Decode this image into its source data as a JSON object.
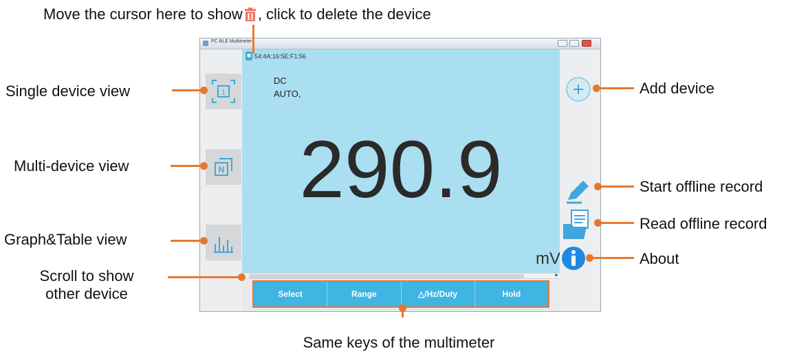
{
  "annotations": {
    "delete_prefix": "Move the cursor here to show",
    "delete_suffix": ", click to delete the device",
    "single_view": "Single device view",
    "multi_view": "Multi-device view",
    "graph_view": "Graph&Table view",
    "scroll_line1": "Scroll to show",
    "scroll_line2": "other device",
    "same_keys": "Same keys of the multimeter",
    "add_device": "Add device",
    "start_record": "Start offline record",
    "read_record": "Read offline record",
    "about": "About"
  },
  "window": {
    "title": "PC BLE Multimeter"
  },
  "device": {
    "address": "54:4A:16:5E:F1:56",
    "mode_line1": "DC",
    "mode_line2": "AUTO,",
    "reading": "290.9",
    "unit": "mV"
  },
  "left_panel": {
    "single_label": "1",
    "multi_label": "N"
  },
  "keys": [
    "Select",
    "Range",
    "△/Hz/Duty",
    "Hold"
  ],
  "colors": {
    "accent_orange": "#e8772e",
    "display_bg": "#a9dff0",
    "key_blue": "#3fb5e3",
    "icon_blue": "#3ea7dc"
  },
  "icons": {
    "trash": "trash-icon",
    "bluetooth": "bluetooth-icon",
    "add": "plus-icon",
    "pen": "pen-icon",
    "folder": "folder-icon",
    "info": "info-icon"
  }
}
